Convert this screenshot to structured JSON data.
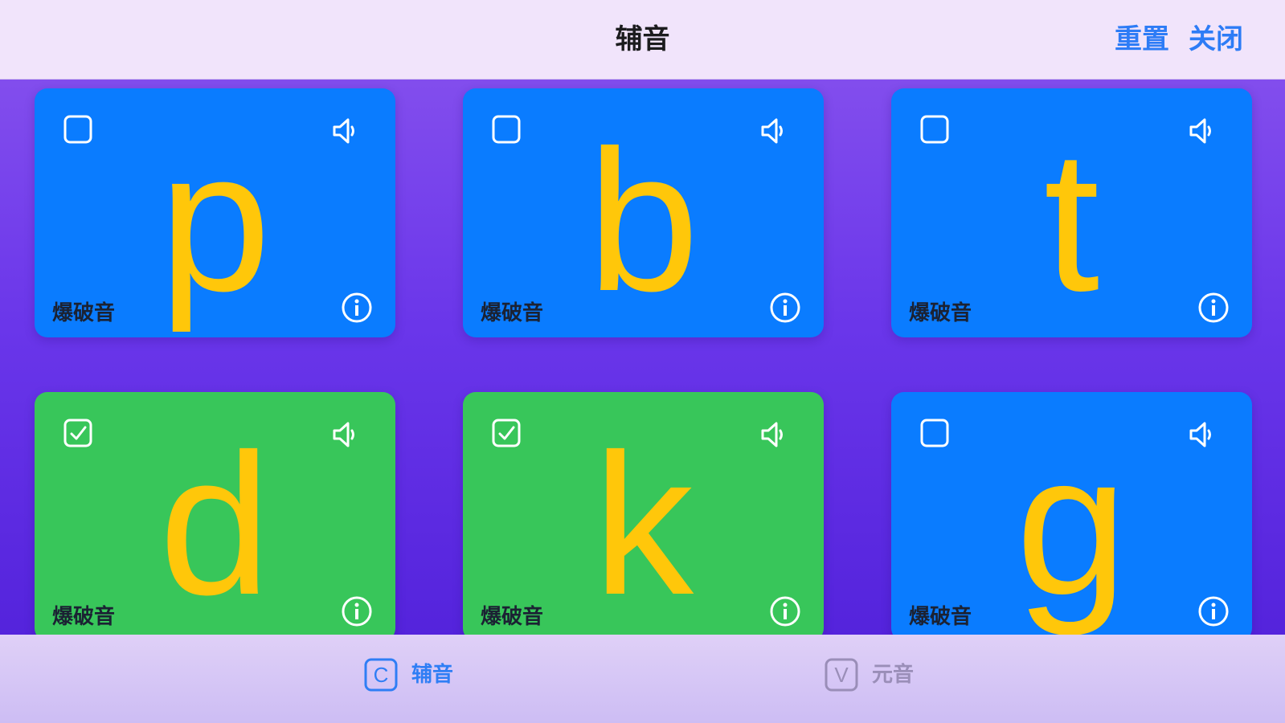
{
  "header": {
    "title": "辅音",
    "reset_label": "重置",
    "close_label": "关闭",
    "accent_color": "#2d7cf6"
  },
  "cards": [
    {
      "letter": "p",
      "label": "爆破音",
      "checked": false,
      "color": "#0a7cff"
    },
    {
      "letter": "b",
      "label": "爆破音",
      "checked": false,
      "color": "#0a7cff"
    },
    {
      "letter": "t",
      "label": "爆破音",
      "checked": false,
      "color": "#0a7cff"
    },
    {
      "letter": "d",
      "label": "爆破音",
      "checked": true,
      "color": "#38c65a"
    },
    {
      "letter": "k",
      "label": "爆破音",
      "checked": true,
      "color": "#38c65a"
    },
    {
      "letter": "g",
      "label": "爆破音",
      "checked": false,
      "color": "#0a7cff"
    }
  ],
  "card_icons": {
    "checkbox": "checkbox-icon",
    "sound": "speaker-icon",
    "info": "info-icon"
  },
  "tabs": [
    {
      "icon_letter": "C",
      "label": "辅音",
      "selected": true
    },
    {
      "icon_letter": "V",
      "label": "元音",
      "selected": false
    }
  ],
  "colors": {
    "letter": "#ffc70a",
    "unchecked_card": "#0a7cff",
    "checked_card": "#38c65a",
    "tab_selected": "#2f7ef5",
    "tab_unselected": "#9a8eb8"
  }
}
